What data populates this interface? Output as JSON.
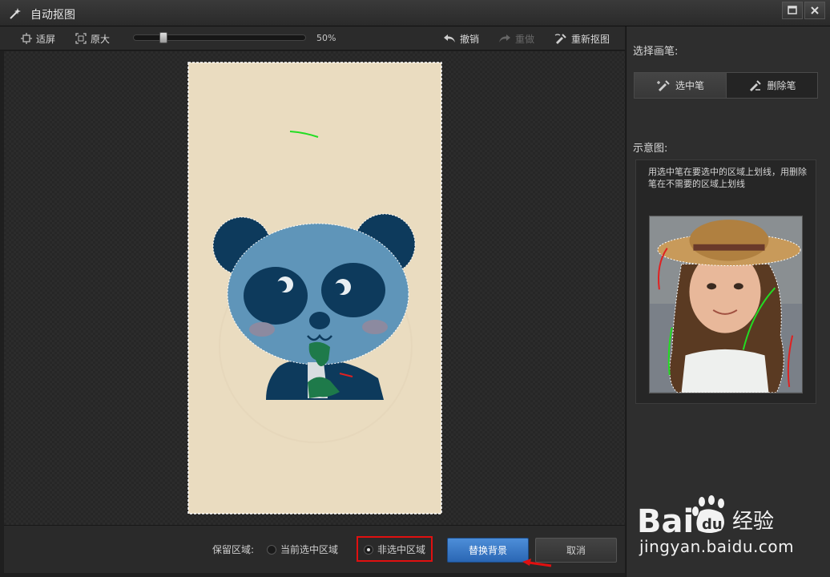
{
  "window": {
    "title": "自动抠图"
  },
  "toolbar": {
    "fit_label": "适屏",
    "original_label": "原大",
    "zoom": "50%",
    "zoom_fraction": 0.16,
    "undo_label": "撤销",
    "redo_label": "重做",
    "reselect_label": "重新抠图"
  },
  "panel": {
    "pen_heading": "选择画笔:",
    "select_pen_label": "选中笔",
    "delete_pen_label": "删除笔",
    "diagram_heading": "示意图:",
    "hint_text": "用选中笔在要选中的区域上划线，用删除笔在不需要的区域上划线"
  },
  "bottom": {
    "keep_label": "保留区域:",
    "option_current": "当前选中区域",
    "option_unselected": "非选中区域",
    "selected_option": "非选中区域",
    "replace_button": "替换背景",
    "cancel_button": "取消"
  },
  "watermark": {
    "brand_exp": "经验",
    "url": "jingyan.baidu.com"
  },
  "colors": {
    "accent_blue": "#3a7bd5",
    "highlight_red": "#e01010",
    "select_stroke": "#22dd22",
    "delete_stroke": "#e02020",
    "image_bg": "#eadcc0",
    "panda_dark": "#0d3a5c",
    "panda_light": "#5f95b9"
  }
}
